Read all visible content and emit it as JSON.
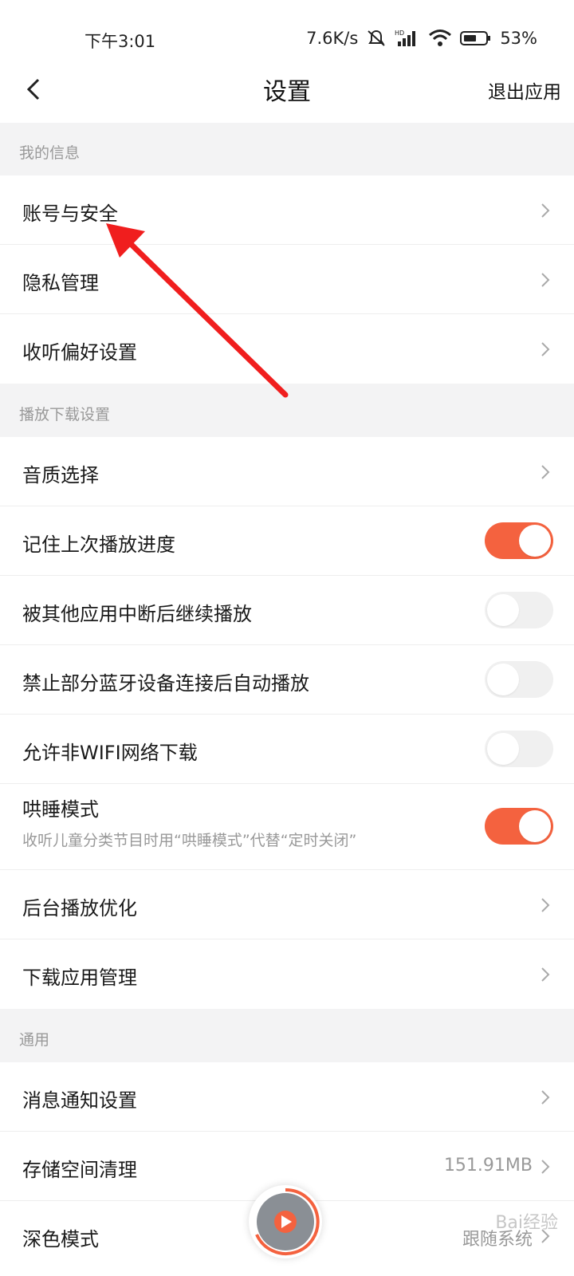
{
  "status_bar": {
    "time": "下午3:01",
    "net_speed": "7.6K/s",
    "battery": "53%",
    "icons": [
      "mute-icon",
      "hd-signal-icon",
      "wifi-icon",
      "battery-icon"
    ]
  },
  "nav": {
    "title": "设置",
    "exit_label": "退出应用",
    "back_icon": "back-arrow-icon"
  },
  "sections": [
    {
      "header": "我的信息"
    },
    {
      "header": "播放下载设置"
    },
    {
      "header": "通用"
    }
  ],
  "rows": {
    "account_security": "账号与安全",
    "privacy": "隐私管理",
    "listening_prefs": "收听偏好设置",
    "audio_quality": "音质选择",
    "remember_progress": {
      "label": "记住上次播放进度",
      "on": true
    },
    "resume_after_interrupt": {
      "label": "被其他应用中断后继续播放",
      "on": false
    },
    "block_bluetooth_autoplay": {
      "label": "禁止部分蓝牙设备连接后自动播放",
      "on": false
    },
    "allow_non_wifi": {
      "label": "允许非WIFI网络下载",
      "on": false
    },
    "sleep_mode": {
      "label": "哄睡模式",
      "sub": "收听儿童分类节目时用“哄睡模式”代替“定时关闭”",
      "on": true
    },
    "background_optimization": "后台播放优化",
    "download_manager": "下载应用管理",
    "notifications": "消息通知设置",
    "storage_cleanup": {
      "label": "存储空间清理",
      "value": "151.91MB"
    },
    "dark_mode": {
      "label": "深色模式",
      "value": "跟随系统"
    }
  },
  "annotation_color": "#f01e1e",
  "accent_color": "#f4623f",
  "watermark": "Bai经验"
}
